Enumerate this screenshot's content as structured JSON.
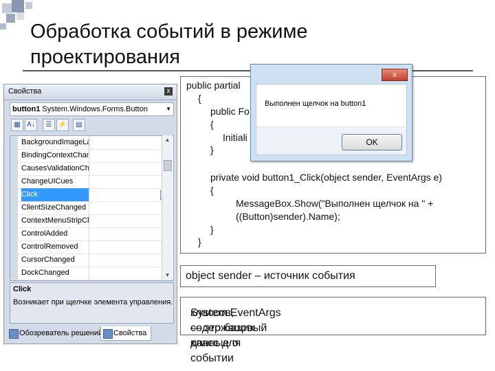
{
  "title": {
    "line1": "Обработка событий в режиме",
    "line2": "проектирования"
  },
  "properties": {
    "header": "Свойства",
    "object": "button1",
    "object_type": "System.Windows.Forms.Button",
    "rows": [
      "BackgroundImageLay",
      "BindingContextChan",
      "CausesValidationCha",
      "ChangeUICues",
      "Click",
      "ClientSizeChanged",
      "ContextMenuStripCh",
      "ControlAdded",
      "ControlRemoved",
      "CursorChanged",
      "DockChanged"
    ],
    "selected_row": "Click",
    "desc_name": "Click",
    "desc_text": "Возникает при щелчке элемента управления.",
    "tab_solution": "Обозреватель решений",
    "tab_props": "Свойства"
  },
  "code": {
    "l1": "public partial",
    "l2": "{",
    "l3": "public Fo",
    "l4": "{",
    "l5": "Initiali",
    "l6": "}",
    "l7": "private void button1_Click(object sender, EventArgs e)",
    "l8": "{",
    "l9": "MessageBox.Show(\"Выполнен щелчок на \" +",
    "l10": "((Button)sender).Name);",
    "l11": "}",
    "l12": "}"
  },
  "messagebox": {
    "close": "x",
    "text": "Выполнен щелчок на button1",
    "ok": "OK"
  },
  "note1": "object sender – источник события",
  "note2_line1": "System.EventArgs — это базовый класс для",
  "note2_line2": "классов, содержащих данные о событии"
}
